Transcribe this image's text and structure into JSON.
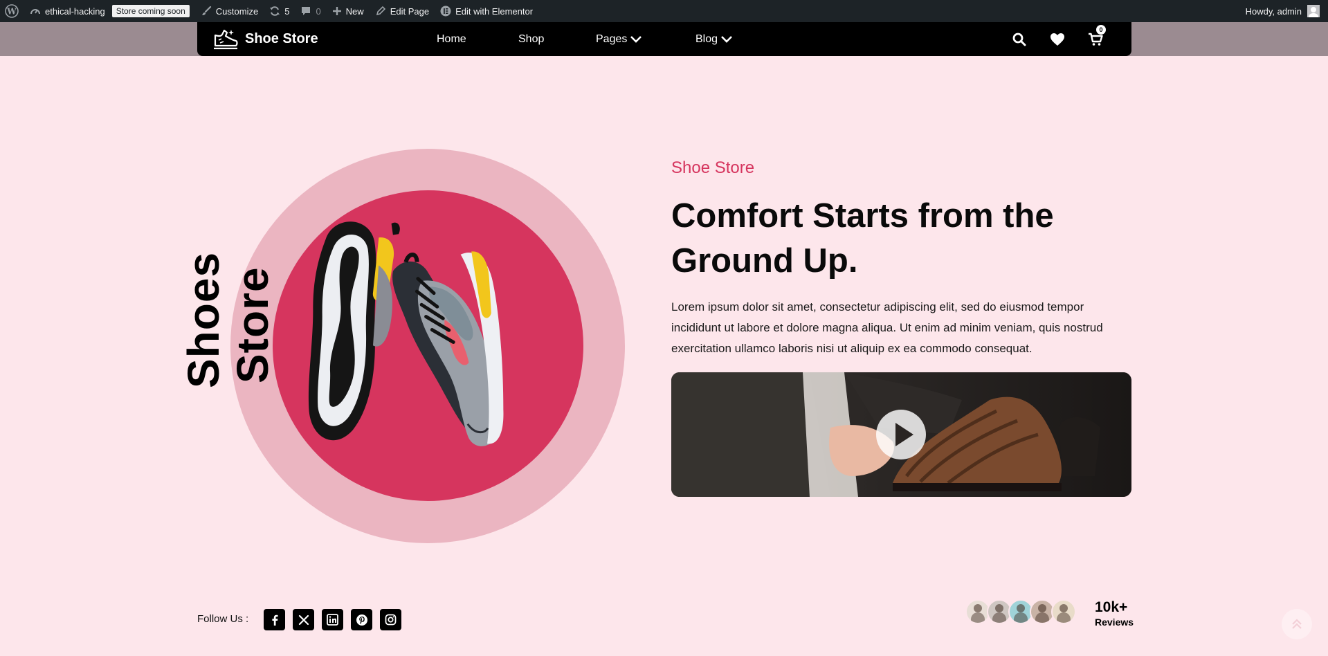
{
  "admin_bar": {
    "site_name": "ethical-hacking",
    "badge": "Store coming soon",
    "customize": "Customize",
    "updates_count": "5",
    "comments_count": "0",
    "new_label": "New",
    "edit_page": "Edit Page",
    "edit_elementor": "Edit with Elementor",
    "greeting": "Howdy, admin"
  },
  "header": {
    "brand": "Shoe Store",
    "nav": [
      "Home",
      "Shop",
      "Pages",
      "Blog"
    ],
    "cart_count": "0"
  },
  "hero": {
    "vertical_words": [
      "Shoes",
      "Store"
    ],
    "eyebrow": "Shoe Store",
    "headline_line1": "Comfort Starts from the",
    "headline_line2": "Ground Up.",
    "body": "Lorem ipsum dolor sit amet, consectetur adipiscing elit, sed do eiusmod tempor incididunt ut labore et dolore magna aliqua. Ut enim ad minim veniam, quis nostrud exercitation ullamco laboris nisi ut aliquip ex ea commodo consequat."
  },
  "footer_row": {
    "follow_label": "Follow Us :",
    "social_icons": [
      "facebook-icon",
      "x-icon",
      "linkedin-icon",
      "pinterest-icon",
      "instagram-icon"
    ],
    "reviews_count": "10k+",
    "reviews_label": "Reviews"
  },
  "colors": {
    "page_background": "#fde6eb",
    "accent": "#d6355e",
    "outer_circle": "#ebb5c1",
    "admin_bar": "#1d2327",
    "nav_background": "#000000"
  }
}
